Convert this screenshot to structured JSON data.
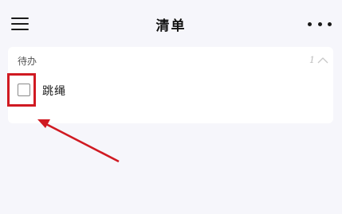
{
  "header": {
    "title": "清单",
    "menu_icon": "menu-icon",
    "more_icon": "more-icon"
  },
  "list": {
    "section_label": "待办",
    "count": "1",
    "collapse_icon": "chevron-up-icon",
    "items": [
      {
        "text": "跳绳",
        "checked": false
      }
    ]
  },
  "annotation": {
    "color": "#d01a22"
  }
}
